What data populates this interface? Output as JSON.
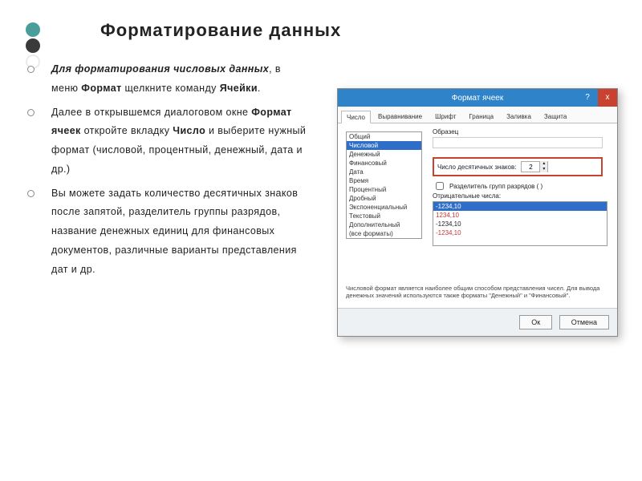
{
  "decor": {
    "colors": [
      "#4a9e9a",
      "#3a3a3a",
      "#eaeaea"
    ]
  },
  "title": "Форматирование  данных",
  "bullets": [
    {
      "runs": [
        {
          "t": "Для  форматирования  числовых  данных",
          "style": "bold ital"
        },
        {
          "t": ",  в  меню ",
          "style": ""
        },
        {
          "t": "Формат",
          "style": "bold"
        },
        {
          "t": "  щелкните  команду ",
          "style": ""
        },
        {
          "t": "Ячейки",
          "style": "bold"
        },
        {
          "t": ".",
          "style": ""
        }
      ]
    },
    {
      "runs": [
        {
          "t": "Далее  в  открывшемся  диалоговом  окне ",
          "style": ""
        },
        {
          "t": "Формат  ячеек",
          "style": "bold"
        },
        {
          "t": "  откройте  вкладку ",
          "style": ""
        },
        {
          "t": "Число",
          "style": "bold"
        },
        {
          "t": "  и  выберите  нужный  формат  (числовой,  процентный,  денежный,  дата  и  др.)",
          "style": ""
        }
      ]
    },
    {
      "runs": [
        {
          "t": "Вы  можете  задать  количество  десятичных  знаков  после  запятой,  разделитель  группы  разрядов,  название  денежных  единиц  для  финансовых  документов,  различные  варианты  представления  дат  и  др.",
          "style": ""
        }
      ]
    }
  ],
  "dialog": {
    "title": "Формат ячеек",
    "help": "?",
    "close": "x",
    "tabs": [
      "Число",
      "Выравнивание",
      "Шрифт",
      "Граница",
      "Заливка",
      "Защита"
    ],
    "active_tab": 0,
    "categories": [
      "Общий",
      "Числовой",
      "Денежный",
      "Финансовый",
      "Дата",
      "Время",
      "Процентный",
      "Дробный",
      "Экспоненциальный",
      "Текстовый",
      "Дополнительный",
      "(все форматы)"
    ],
    "selected_category": 1,
    "sample_label": "Образец",
    "decimals_label": "Число десятичных знаков:",
    "decimals_value": "2",
    "sep_label": "Разделитель групп разрядов ( )",
    "neg_label": "Отрицательные числа:",
    "neg_options": [
      {
        "text": "-1234,10",
        "red": false,
        "sel": true
      },
      {
        "text": "1234,10",
        "red": true,
        "sel": false
      },
      {
        "text": "-1234,10",
        "red": false,
        "sel": false
      },
      {
        "text": "-1234,10",
        "red": true,
        "sel": false
      }
    ],
    "desc": "Числовой формат является наиболее общим способом представления чисел. Для вывода денежных значений используются также форматы \"Денежный\" и \"Финансовый\".",
    "ok": "Ок",
    "cancel": "Отмена"
  }
}
